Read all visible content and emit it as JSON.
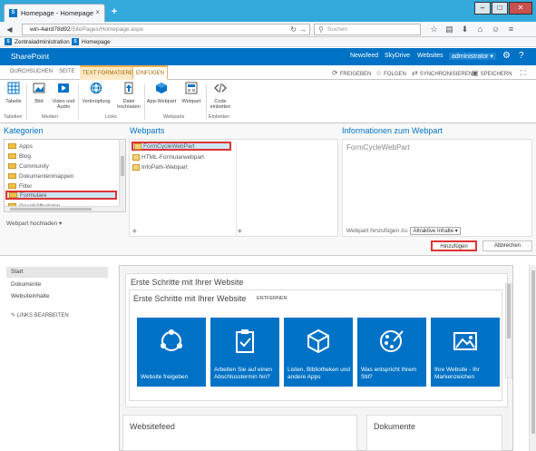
{
  "browser": {
    "tab_title": "Homepage - Homepage",
    "tab_close": "×",
    "new_tab": "+",
    "url_host": "win-4aird78d92",
    "url_path": "/SitePages/Homepage.aspx",
    "search_placeholder": "Suchen",
    "bookmarks": [
      "Zentraladministration",
      "Homepage"
    ]
  },
  "suite": {
    "brand": "SharePoint",
    "links": [
      "Newsfeed",
      "SkyDrive",
      "Websites"
    ],
    "user": "administrator ▾"
  },
  "ribbon": {
    "tabs": [
      "DURCHSUCHEN",
      "SEITE"
    ],
    "context_tabs": [
      "TEXT FORMATIEREN",
      "EINFÜGEN"
    ],
    "actions": [
      "FREIGEBEN",
      "FOLGEN",
      "SYNCHRONISIEREN",
      "SPEICHERN"
    ],
    "buttons": {
      "tabelle": "Tabelle",
      "bild": "Bild",
      "video": "Video und Audio",
      "verknuepfung": "Verknüpfung",
      "datei": "Datei hochladen",
      "app_webpart": "App-Webpart",
      "webpart": "Webpart",
      "code": "Code einbetten"
    },
    "groups": [
      "Tabellen",
      "Medien",
      "Links",
      "Webparts",
      "Einbetten"
    ]
  },
  "adder": {
    "kategorien_title": "Kategorien",
    "webparts_title": "Webparts",
    "info_title": "Informationen zum Webpart",
    "categories": [
      "Apps",
      "Blog",
      "Community",
      "Dokumentenmappen",
      "Filter",
      "Formulare",
      "Geschäftsdaten"
    ],
    "selected_category": "Formulare",
    "upload_label": "Webpart hochladen ▾",
    "webparts": [
      "FormCycleWebPart",
      "HTML-Formularwebpart",
      "InfoPath-Webpart"
    ],
    "selected_webpart": "FormCycleWebPart",
    "info_name": "FormCycleWebPart",
    "zone_label": "Webpart hinzufügen zu:",
    "zone_value": "Attraktive Inhalte",
    "add_button": "Hinzufügen",
    "cancel_button": "Abbrechen"
  },
  "leftnav": {
    "items": [
      "Start",
      "Dokumente",
      "Websiteinhalte"
    ],
    "edit_links": "LINKS BEARBEITEN"
  },
  "main": {
    "erste_title": "Erste Schritte mit Ihrer Website",
    "inner_title": "Erste Schritte mit Ihrer Website",
    "remove_label": "ENTFERNEN",
    "tiles": [
      "Website freigeben",
      "Arbeiten Sie auf einen Abschlusstermin hin?",
      "Listen, Bibliotheken und andere Apps",
      "Was entspricht Ihrem Stil?",
      "Ihre Website - Ihr Markenzeichen"
    ],
    "feed_title": "Websitefeed",
    "docs_title": "Dokumente"
  },
  "colors": {
    "accent": "#0072c6",
    "highlight_border": "#dd3333",
    "titlebar": "#33a9dc"
  }
}
